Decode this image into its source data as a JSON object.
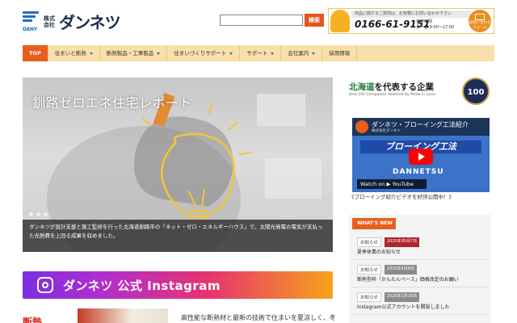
{
  "header": {
    "logo_mark": "DANY",
    "logo_small": "株式会社",
    "logo_name": "ダンネツ",
    "search_placeholder": "",
    "search_button": "検索",
    "phone_banner": {
      "top_text": "商品に関するご質問は、お気軽にお問い合わせ下さい",
      "phone": "0166-61-9151",
      "hours_label": "受付時間",
      "hours": "月～金 9:00～17:00",
      "mail_label": "お問い合わせフォーム"
    }
  },
  "nav": {
    "items": [
      {
        "label": "TOP",
        "active": true,
        "has_caret": false
      },
      {
        "label": "住まいと断熱",
        "active": false,
        "has_caret": true
      },
      {
        "label": "断熱製品・工事製品",
        "active": false,
        "has_caret": true
      },
      {
        "label": "住まいづくりサポート",
        "active": false,
        "has_caret": true
      },
      {
        "label": "サポート",
        "active": false,
        "has_caret": true
      },
      {
        "label": "会社案内",
        "active": false,
        "has_caret": true
      },
      {
        "label": "採用情報",
        "active": false,
        "has_caret": false
      }
    ]
  },
  "hero": {
    "title": "釧路ゼロエネ住宅レポート",
    "caption": "ダンネツが設計支援と施工監修を行った北海道釧路市の「ネット・ゼロ・エネルギーハウス」で、太陽光発電の電気が支払った光熱費を上回る成果を収めました。"
  },
  "instagram": {
    "label": "ダンネツ 公式 Instagram"
  },
  "bottom": {
    "badge": "断熱",
    "text": "高性能な断熱材と最新の技術で住まいを夏涼しく、冬"
  },
  "sidebar": {
    "best100": {
      "title_hl": "北海道",
      "title_rest": "を代表する企業",
      "subtitle": "Best 100 Companies Selected By Made In Local",
      "badge": "100"
    },
    "video": {
      "title": "ダンネツ・ブローイング工法紹介",
      "channel": "株式会社ダンネツ",
      "banner": "ブローイング工法",
      "brand": "DANNETSU",
      "watch": "Watch on ▶ YouTube",
      "caption": "《ブローイング紹介ビデオを好評公開中！》"
    },
    "news": {
      "header": "WHAT'S NEW",
      "items": [
        {
          "category": "お知らせ",
          "date": "2020年05月7日",
          "date_color": "#b0232a",
          "title": "夏季休業のお知らせ"
        },
        {
          "category": "お知らせ",
          "date": "2020年4月8日",
          "date_color": "#8b8b8b",
          "title": "断熱型枠「かんたんベース」価格改定のお願い"
        },
        {
          "category": "お知らせ",
          "date": "2020年1月28日",
          "date_color": "#8b8b8b",
          "title": "Instagram公式アカウントを開設しました"
        }
      ]
    }
  },
  "colors": {
    "accent": "#e95e1c",
    "nav_bg": "#f9dfa9",
    "brand_blue": "#1f6fc0"
  }
}
